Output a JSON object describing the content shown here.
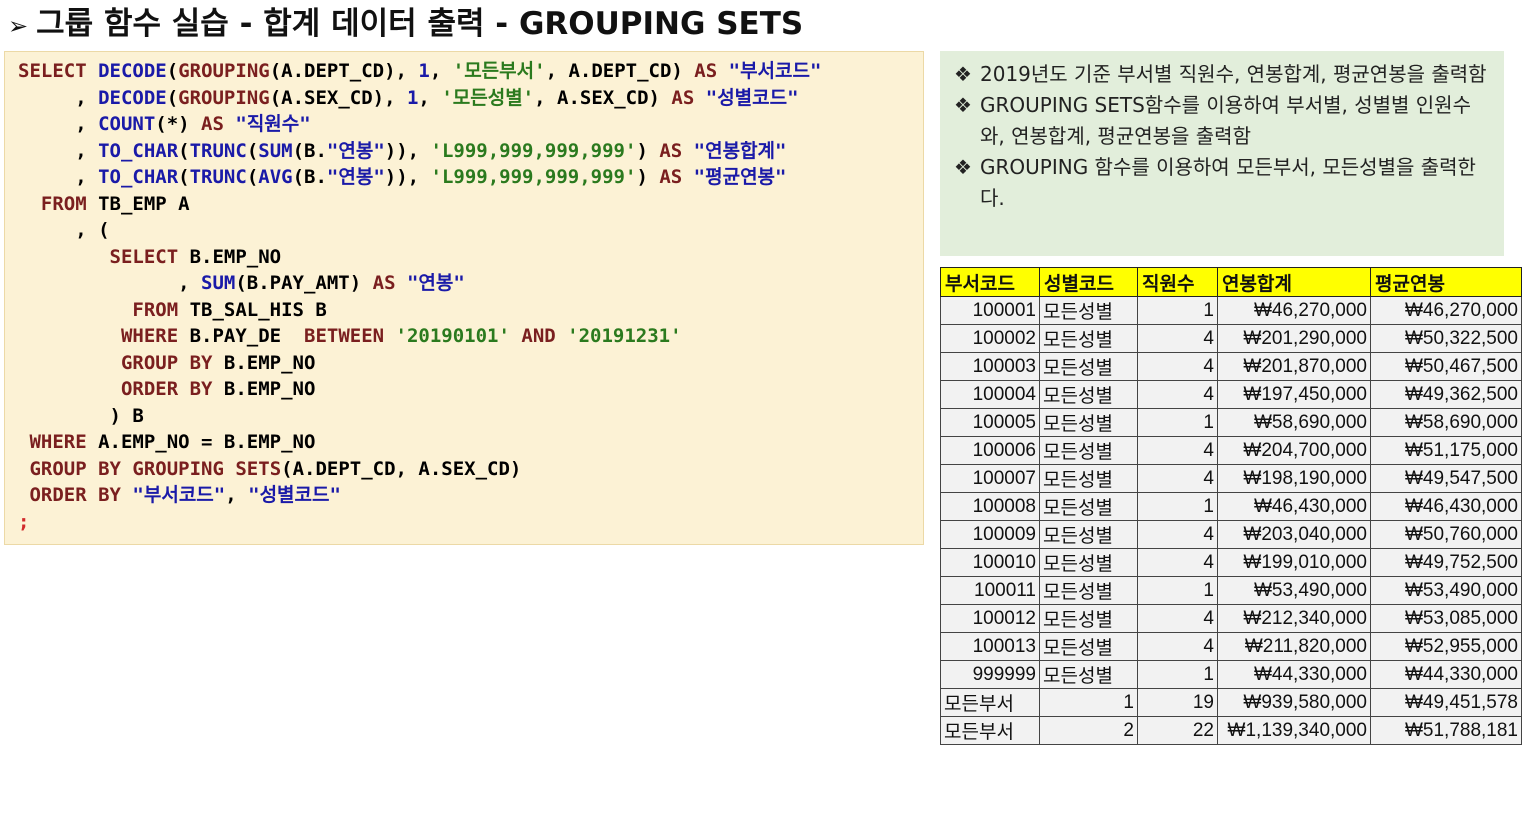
{
  "title": {
    "arrow": "➢",
    "text": "그룹 함수 실습 - 합계 데이터 출력 - GROUPING SETS"
  },
  "notes": [
    {
      "bullet": "❖",
      "text": "2019년도 기준 부서별 직원수, 연봉합계, 평균연봉을 출력함"
    },
    {
      "bullet": "❖",
      "text": "GROUPING SETS함수를 이용하여 부서별, 성별별 인원수와, 연봉합계, 평균연봉을 출력함"
    },
    {
      "bullet": "❖",
      "text": "GROUPING 함수를 이용하여 모든부서, 모든성별을 출력한다."
    }
  ],
  "table": {
    "headers": [
      "부서코드",
      "성별코드",
      "직원수",
      "연봉합계",
      "평균연봉"
    ],
    "rows": [
      [
        "100001",
        "모든성별",
        "1",
        "₩46,270,000",
        "₩46,270,000"
      ],
      [
        "100002",
        "모든성별",
        "4",
        "₩201,290,000",
        "₩50,322,500"
      ],
      [
        "100003",
        "모든성별",
        "4",
        "₩201,870,000",
        "₩50,467,500"
      ],
      [
        "100004",
        "모든성별",
        "4",
        "₩197,450,000",
        "₩49,362,500"
      ],
      [
        "100005",
        "모든성별",
        "1",
        "₩58,690,000",
        "₩58,690,000"
      ],
      [
        "100006",
        "모든성별",
        "4",
        "₩204,700,000",
        "₩51,175,000"
      ],
      [
        "100007",
        "모든성별",
        "4",
        "₩198,190,000",
        "₩49,547,500"
      ],
      [
        "100008",
        "모든성별",
        "1",
        "₩46,430,000",
        "₩46,430,000"
      ],
      [
        "100009",
        "모든성별",
        "4",
        "₩203,040,000",
        "₩50,760,000"
      ],
      [
        "100010",
        "모든성별",
        "4",
        "₩199,010,000",
        "₩49,752,500"
      ],
      [
        "100011",
        "모든성별",
        "1",
        "₩53,490,000",
        "₩53,490,000"
      ],
      [
        "100012",
        "모든성별",
        "4",
        "₩212,340,000",
        "₩53,085,000"
      ],
      [
        "100013",
        "모든성별",
        "4",
        "₩211,820,000",
        "₩52,955,000"
      ],
      [
        "999999",
        "모든성별",
        "1",
        "₩44,330,000",
        "₩44,330,000"
      ],
      [
        "모든부서",
        "1",
        "19",
        "₩939,580,000",
        "₩49,451,578"
      ],
      [
        "모든부서",
        "2",
        "22",
        "₩1,139,340,000",
        "₩51,788,181"
      ]
    ]
  },
  "code": {
    "l1": {
      "a": "SELECT",
      "b": " ",
      "c": "DECODE",
      "d": "(",
      "e": "GROUPING",
      "f": "(A.DEPT_CD), ",
      "g": "1",
      "h": ", ",
      "i": "'모든부서'",
      "j": ", A.DEPT_CD) ",
      "k": "AS",
      "l": " ",
      "m": "\"부서코드\""
    },
    "l2": {
      "a": "     , ",
      "b": "DECODE",
      "c": "(",
      "d": "GROUPING",
      "e": "(A.SEX_CD), ",
      "f": "1",
      "g": ", ",
      "h": "'모든성별'",
      "i": ", A.SEX_CD) ",
      "j": "AS",
      "k": " ",
      "l": "\"성별코드\""
    },
    "l3": {
      "a": "     , ",
      "b": "COUNT",
      "c": "(*) ",
      "d": "AS",
      "e": " ",
      "f": "\"직원수\""
    },
    "l4": {
      "a": "     , ",
      "b": "TO_CHAR",
      "c": "(",
      "d": "TRUNC",
      "e": "(",
      "f": "SUM",
      "g": "(B.",
      "h": "\"연봉\"",
      "i": ")), ",
      "j": "'L999,999,999,999'",
      "k": ") ",
      "l": "AS",
      "m": " ",
      "n": "\"연봉합계\""
    },
    "l5": {
      "a": "     , ",
      "b": "TO_CHAR",
      "c": "(",
      "d": "TRUNC",
      "e": "(",
      "f": "AVG",
      "g": "(B.",
      "h": "\"연봉\"",
      "i": ")), ",
      "j": "'L999,999,999,999'",
      "k": ") ",
      "l": "AS",
      "m": " ",
      "n": "\"평균연봉\""
    },
    "l6": {
      "a": "  ",
      "b": "FROM",
      "c": " TB_EMP A"
    },
    "l7": {
      "a": "     , ("
    },
    "l8": {
      "a": "        ",
      "b": "SELECT",
      "c": " B.EMP_NO"
    },
    "l9": {
      "a": "              , ",
      "b": "SUM",
      "c": "(B.PAY_AMT) ",
      "d": "AS",
      "e": " ",
      "f": "\"연봉\""
    },
    "l10": {
      "a": "          ",
      "b": "FROM",
      "c": " TB_SAL_HIS B"
    },
    "l11": {
      "a": "         ",
      "b": "WHERE",
      "c": " B.PAY_DE  ",
      "d": "BETWEEN",
      "e": " ",
      "f": "'20190101'",
      "g": " ",
      "h": "AND",
      "i": " ",
      "j": "'20191231'"
    },
    "l12": {
      "a": "         ",
      "b": "GROUP BY",
      "c": " B.EMP_NO"
    },
    "l13": {
      "a": "         ",
      "b": "ORDER BY",
      "c": " B.EMP_NO"
    },
    "l14": {
      "a": "        ) B"
    },
    "l15": {
      "a": " ",
      "b": "WHERE",
      "c": " A.EMP_NO = B.EMP_NO"
    },
    "l16": {
      "a": " ",
      "b": "GROUP BY",
      "c": " ",
      "d": "GROUPING SETS",
      "e": "(A.DEPT_CD, A.SEX_CD)"
    },
    "l17": {
      "a": " ",
      "b": "ORDER BY",
      "c": " ",
      "d": "\"부서코드\"",
      "e": ", ",
      "f": "\"성별코드\""
    },
    "l18": {
      "a": ";"
    }
  }
}
